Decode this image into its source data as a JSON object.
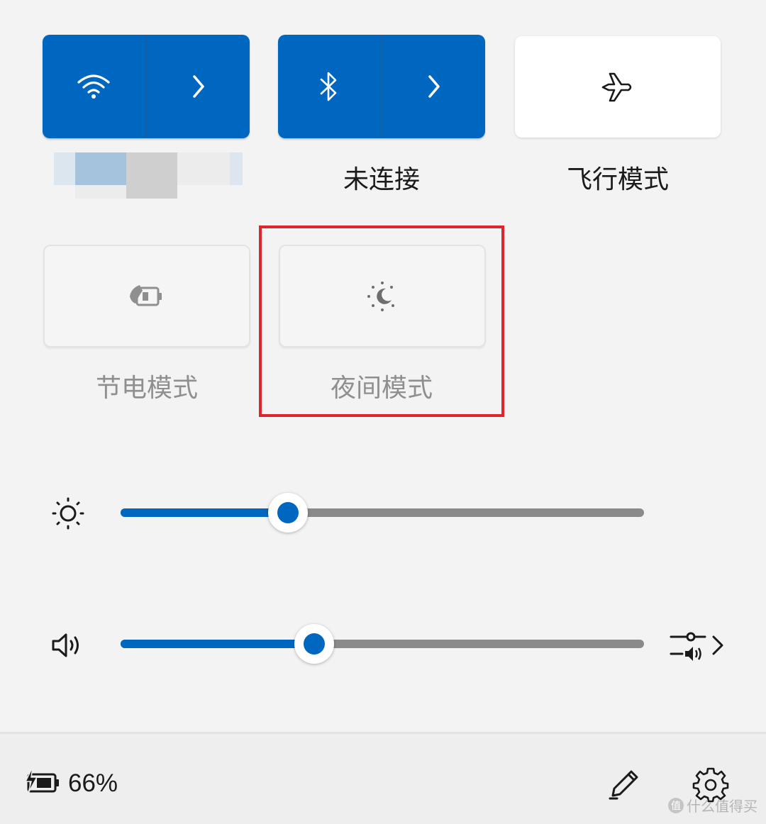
{
  "tiles": {
    "wifi": {
      "network_name_hidden": true
    },
    "bluetooth": {
      "label": "未连接"
    },
    "airplane": {
      "label": "飞行模式"
    },
    "battery_saver": {
      "label": "节电模式"
    },
    "night_light": {
      "label": "夜间模式"
    }
  },
  "sliders": {
    "brightness": {
      "value_percent": 32
    },
    "volume": {
      "value_percent": 37
    }
  },
  "footer": {
    "battery_percent": "66%"
  },
  "watermark": {
    "text": "什么值得买",
    "badge": "值"
  },
  "colors": {
    "accent": "#0067c0",
    "highlight_box": "#e0242b",
    "background": "#f3f3f3"
  },
  "icons": {
    "wifi": "wifi-icon",
    "bluetooth": "bluetooth-icon",
    "airplane": "airplane-icon",
    "battery_saver": "battery-saver-icon",
    "night_light": "night-light-icon",
    "brightness": "brightness-icon",
    "volume": "volume-icon",
    "audio_output": "audio-output-icon",
    "battery": "battery-charging-icon",
    "edit": "pencil-icon",
    "settings": "gear-icon"
  }
}
